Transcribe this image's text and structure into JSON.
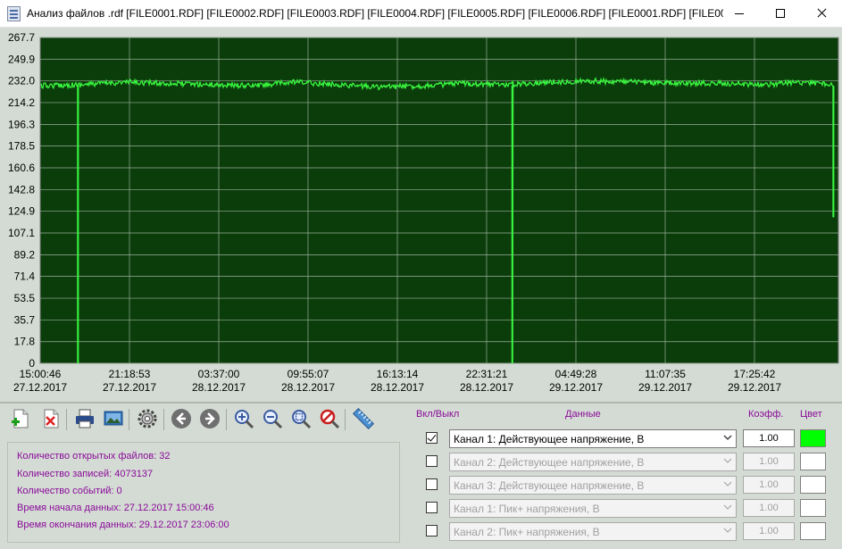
{
  "window": {
    "title": "Анализ файлов .rdf [FILE0001.RDF] [FILE0002.RDF] [FILE0003.RDF] [FILE0004.RDF] [FILE0005.RDF] [FILE0006.RDF] [FILE0001.RDF] [FILE0002.RDF] [FI..."
  },
  "colors": {
    "plot_bg": "#0b3d0b",
    "grid": "#9aaf9a",
    "series": "#39f53f",
    "accent_text": "#8a0b9a"
  },
  "chart_data": {
    "type": "line",
    "title": "",
    "xlabel": "",
    "ylabel": "",
    "ylim": [
      0,
      267.7
    ],
    "y_ticks": [
      "267.7",
      "249.9",
      "232.0",
      "214.2",
      "196.3",
      "178.5",
      "160.6",
      "142.8",
      "124.9",
      "107.1",
      "89.2",
      "71.4",
      "53.5",
      "35.7",
      "17.8",
      "0"
    ],
    "x_ticks": [
      {
        "time": "15:00:46",
        "date": "27.12.2017"
      },
      {
        "time": "21:18:53",
        "date": "27.12.2017"
      },
      {
        "time": "03:37:00",
        "date": "28.12.2017"
      },
      {
        "time": "09:55:07",
        "date": "28.12.2017"
      },
      {
        "time": "16:13:14",
        "date": "28.12.2017"
      },
      {
        "time": "22:31:21",
        "date": "28.12.2017"
      },
      {
        "time": "04:49:28",
        "date": "29.12.2017"
      },
      {
        "time": "11:07:35",
        "date": "29.12.2017"
      },
      {
        "time": "17:25:42",
        "date": "29.12.2017"
      }
    ],
    "grid": true,
    "series": [
      {
        "x": [
          "27.12.2017 15:00",
          "27.12.2017 18:00",
          "27.12.2017 21:00",
          "28.12.2017 00:00",
          "28.12.2017 03:00",
          "28.12.2017 06:00",
          "28.12.2017 09:00",
          "28.12.2017 12:00",
          "28.12.2017 15:00",
          "28.12.2017 18:00",
          "28.12.2017 21:00",
          "29.12.2017 00:00",
          "29.12.2017 03:00",
          "29.12.2017 06:00",
          "29.12.2017 09:00",
          "29.12.2017 12:00",
          "29.12.2017 15:00",
          "29.12.2017 18:00",
          "29.12.2017 21:00",
          "29.12.2017 23:00"
        ],
        "y": [
          228,
          229,
          231,
          230,
          229,
          228,
          231,
          229,
          227,
          228,
          230,
          229,
          231,
          232,
          231,
          230,
          230,
          229,
          231,
          229
        ],
        "dips": [
          {
            "at": "27.12.2017 17:41",
            "value": 0
          },
          {
            "at": "29.12.2017 00:20",
            "value": 0
          },
          {
            "at": "29.12.2017 23:00",
            "value": 120
          }
        ]
      }
    ]
  },
  "toolbar": {
    "buttons": [
      {
        "name": "add-file-icon"
      },
      {
        "name": "remove-file-icon"
      },
      {
        "name": "print-icon"
      },
      {
        "name": "export-image-icon"
      },
      {
        "name": "settings-gear-icon"
      },
      {
        "name": "back-arrow-icon"
      },
      {
        "name": "forward-arrow-icon"
      },
      {
        "name": "zoom-in-icon"
      },
      {
        "name": "zoom-out-icon"
      },
      {
        "name": "zoom-fit-icon"
      },
      {
        "name": "zoom-reset-icon"
      },
      {
        "name": "ruler-measure-icon"
      }
    ]
  },
  "info": {
    "open_files": "Количество открытых файлов: 32",
    "records": "Количество записей: 4073137",
    "events": "Количество событий: 0",
    "start": "Время начала данных: 27.12.2017 15:00:46",
    "end": "Время окончания данных: 29.12.2017 23:06:00"
  },
  "channels_panel": {
    "headers": {
      "onoff": "Вкл/Выкл",
      "data": "Данные",
      "coef": "Коэфф.",
      "color": "Цвет"
    },
    "rows": [
      {
        "label": "Канал 1: Действующее напряжение, В",
        "coef": "1.00",
        "checked": true,
        "color": "#00ff00"
      },
      {
        "label": "Канал 2: Действующее напряжение, В",
        "coef": "1.00",
        "checked": false,
        "color": "#ffffff"
      },
      {
        "label": "Канал 3: Действующее напряжение, В",
        "coef": "1.00",
        "checked": false,
        "color": "#ffffff"
      },
      {
        "label": "Канал 1: Пик+ напряжения, В",
        "coef": "1.00",
        "checked": false,
        "color": "#ffffff"
      },
      {
        "label": "Канал 2: Пик+ напряжения, В",
        "coef": "1.00",
        "checked": false,
        "color": "#ffffff"
      }
    ]
  }
}
